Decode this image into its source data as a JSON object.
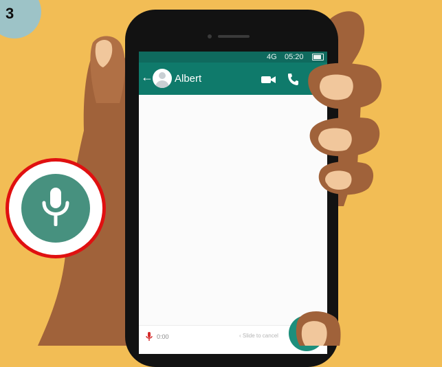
{
  "step": {
    "number": "3"
  },
  "status_bar": {
    "network": "4G",
    "time": "05:20"
  },
  "chat_header": {
    "back_icon": "arrow-left-icon",
    "contact_name": "Albert",
    "video_icon": "video-camera-icon",
    "call_icon": "phone-icon"
  },
  "recorder": {
    "timer": "0:00",
    "slide_to_cancel": "Slide to cancel",
    "mic_icon": "microphone-icon"
  },
  "highlight": {
    "icon": "microphone-icon",
    "ring_color": "#e01010"
  },
  "colors": {
    "background": "#f2bd55",
    "header_green": "#0f7a6b",
    "mic_button_green": "#47917f",
    "skin": "#a0623a"
  }
}
